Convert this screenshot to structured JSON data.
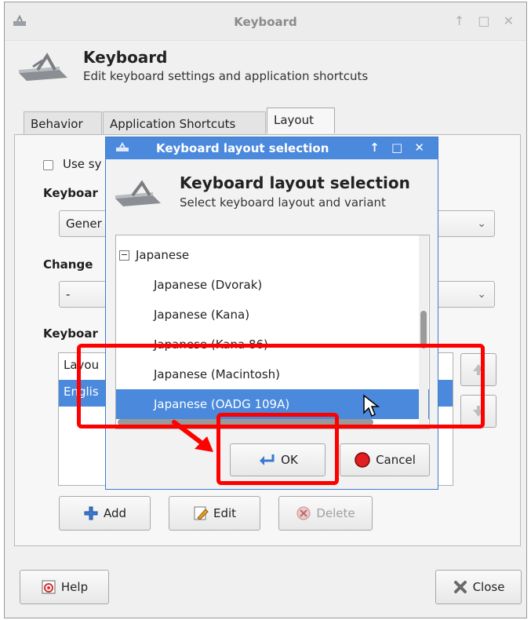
{
  "window": {
    "title": "Keyboard",
    "header_title": "Keyboard",
    "header_subtitle": "Edit keyboard settings and application shortcuts"
  },
  "tabs": [
    {
      "label": "Behavior"
    },
    {
      "label": "Application Shortcuts"
    },
    {
      "label": "Layout",
      "active": true
    }
  ],
  "layout_tab": {
    "use_system_defaults_label": "Use sy",
    "keyboard_model_label": "Keyboar",
    "keyboard_model_value": "Gener",
    "change_layout_label": "Change",
    "change_layout_value": "-",
    "keyboard_layout_label": "Keyboar",
    "layout_list_header": "Layou",
    "layout_list_row": "Englis",
    "add_label": "Add",
    "edit_label": "Edit",
    "delete_label": "Delete"
  },
  "bottom": {
    "help_label": "Help",
    "close_label": "Close"
  },
  "dialog": {
    "title": "Keyboard layout selection",
    "header_title": "Keyboard layout selection",
    "header_subtitle": "Select keyboard layout and variant",
    "tree_parent": "Japanese",
    "tree_items": [
      "Japanese (Dvorak)",
      "Japanese (Kana)",
      "Japanese (Kana 86)",
      "Japanese (Macintosh)",
      "Japanese (OADG 109A)"
    ],
    "selected_item": "Japanese (OADG 109A)",
    "ok_label": "OK",
    "cancel_label": "Cancel"
  },
  "colors": {
    "accent": "#4a89dc",
    "annotation": "#ff0000"
  }
}
